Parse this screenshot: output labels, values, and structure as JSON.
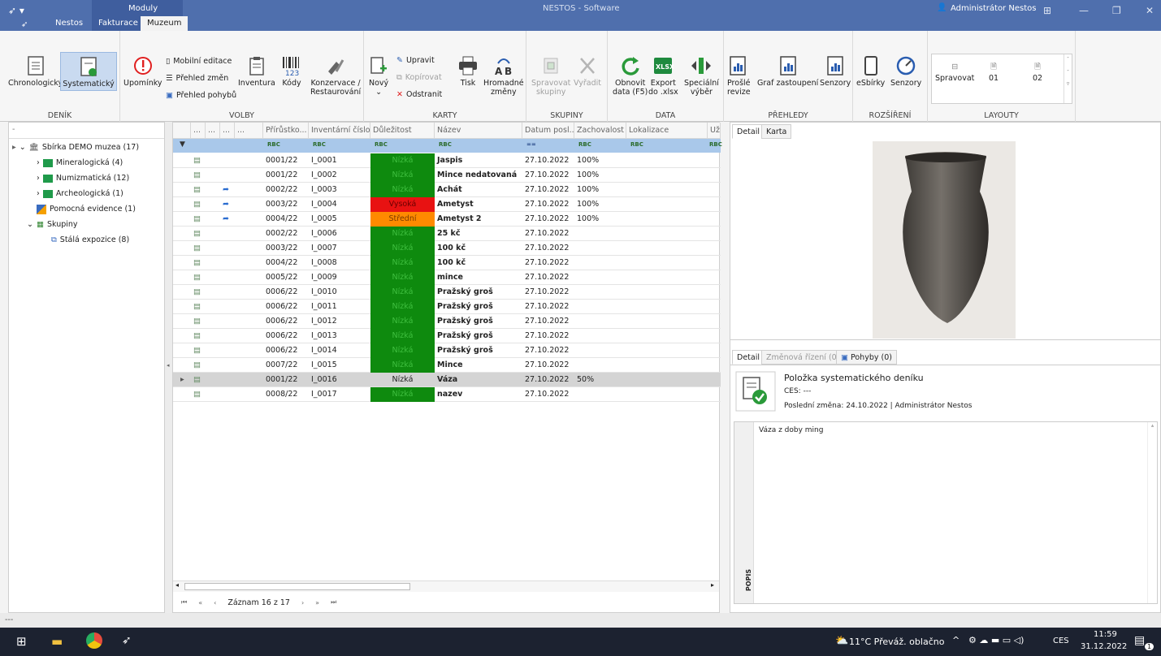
{
  "window": {
    "title": "NESTOS - Software",
    "context_tab": "Moduly",
    "user": "Administrátor Nestos"
  },
  "menu_tabs": [
    "Nestos",
    "Fakturace",
    "Muzeum"
  ],
  "ribbon": {
    "denik": {
      "caption": "DENÍK",
      "chronologicky": "Chronologický",
      "systematicky": "Systematický"
    },
    "volby": {
      "caption": "VOLBY",
      "upominky": "Upomínky",
      "mobilni_editace": "Mobilní editace",
      "prehled_zmen": "Přehled změn",
      "prehled_pohybu": "Přehled pohybů",
      "inventura": "Inventura",
      "kody": "Kódy",
      "konzervace_l1": "Konzervace /",
      "konzervace_l2": "Restaurování"
    },
    "karty": {
      "caption": "KARTY",
      "novy": "Nový",
      "upravit": "Upravit",
      "kopirovat": "Kopírovat",
      "odstranit": "Odstranit",
      "tisk": "Tisk",
      "hromadne_l1": "Hromadné",
      "hromadne_l2": "změny"
    },
    "skupiny": {
      "caption": "SKUPINY",
      "spravovat_l1": "Spravovat",
      "spravovat_l2": "skupiny",
      "vyradit": "Vyřadit"
    },
    "data": {
      "caption": "DATA",
      "obnovit_l1": "Obnovit",
      "obnovit_l2": "data (F5)",
      "export_l1": "Export",
      "export_l2": "do .xlsx",
      "specialni_l1": "Speciální",
      "specialni_l2": "výběr"
    },
    "prehledy": {
      "caption": "PŘEHLEDY",
      "prosle_l1": "Prošlé",
      "prosle_l2": "revize",
      "graf": "Graf zastoupení",
      "senzory": "Senzory"
    },
    "rozsireni": {
      "caption": "ROZŠÍŘENÍ",
      "esbirky": "eSbírky",
      "senzory": "Senzory"
    },
    "layouty": {
      "caption": "LAYOUTY",
      "spravovat": "Spravovat",
      "l01": "01",
      "l02": "02"
    }
  },
  "tree": {
    "header": "-",
    "items": [
      {
        "label": "Sbírka DEMO muzea (17)"
      },
      {
        "label": "Mineralogická (4)"
      },
      {
        "label": "Numizmatická (12)"
      },
      {
        "label": "Archeologická (1)"
      },
      {
        "label": "Pomocná evidence (1)"
      },
      {
        "label": "Skupiny"
      },
      {
        "label": "Stálá expozice (8)"
      }
    ]
  },
  "grid": {
    "columns": {
      "c1": "...",
      "c2": "...",
      "c3": "...",
      "c4": "...",
      "prirustek": "Přírůstko...",
      "inv": "Inventární číslo",
      "dulezitost": "Důležitost",
      "nazev": "Název",
      "datum": "Datum posl...",
      "zach": "Zachovalost",
      "lokalizace": "Lokalizace",
      "uz": "Už"
    },
    "filter": {
      "tag": "RBC",
      "eq": "=="
    },
    "rows": [
      {
        "p": "0001/22",
        "i": "I_0001",
        "d": "Nízká",
        "n": "Jaspis",
        "dt": "27.10.2022",
        "z": "100%"
      },
      {
        "p": "0001/22",
        "i": "I_0002",
        "d": "Nízká",
        "n": "Mince nedatovaná",
        "dt": "27.10.2022",
        "z": "100%"
      },
      {
        "p": "0002/22",
        "i": "I_0003",
        "d": "Nízká",
        "n": "Achát",
        "dt": "27.10.2022",
        "z": "100%"
      },
      {
        "p": "0003/22",
        "i": "I_0004",
        "d": "Vysoká",
        "n": "Ametyst",
        "dt": "27.10.2022",
        "z": "100%"
      },
      {
        "p": "0004/22",
        "i": "I_0005",
        "d": "Střední",
        "n": "Ametyst 2",
        "dt": "27.10.2022",
        "z": "100%"
      },
      {
        "p": "0002/22",
        "i": "I_0006",
        "d": "Nízká",
        "n": "25 kč",
        "dt": "27.10.2022",
        "z": ""
      },
      {
        "p": "0003/22",
        "i": "I_0007",
        "d": "Nízká",
        "n": "100 kč",
        "dt": "27.10.2022",
        "z": ""
      },
      {
        "p": "0004/22",
        "i": "I_0008",
        "d": "Nízká",
        "n": "100 kč",
        "dt": "27.10.2022",
        "z": ""
      },
      {
        "p": "0005/22",
        "i": "I_0009",
        "d": "Nízká",
        "n": "mince",
        "dt": "27.10.2022",
        "z": ""
      },
      {
        "p": "0006/22",
        "i": "I_0010",
        "d": "Nízká",
        "n": "Pražský groš",
        "dt": "27.10.2022",
        "z": ""
      },
      {
        "p": "0006/22",
        "i": "I_0011",
        "d": "Nízká",
        "n": "Pražský groš",
        "dt": "27.10.2022",
        "z": ""
      },
      {
        "p": "0006/22",
        "i": "I_0012",
        "d": "Nízká",
        "n": "Pražský groš",
        "dt": "27.10.2022",
        "z": ""
      },
      {
        "p": "0006/22",
        "i": "I_0013",
        "d": "Nízká",
        "n": "Pražský groš",
        "dt": "27.10.2022",
        "z": ""
      },
      {
        "p": "0006/22",
        "i": "I_0014",
        "d": "Nízká",
        "n": "Pražský groš",
        "dt": "27.10.2022",
        "z": ""
      },
      {
        "p": "0007/22",
        "i": "I_0015",
        "d": "Nízká",
        "n": "Mince",
        "dt": "27.10.2022",
        "z": ""
      },
      {
        "p": "0001/22",
        "i": "I_0016",
        "d": "Nízká",
        "n": "Váza",
        "dt": "27.10.2022",
        "z": "50%"
      },
      {
        "p": "0008/22",
        "i": "I_0017",
        "d": "Nízká",
        "n": "nazev",
        "dt": "27.10.2022",
        "z": ""
      }
    ],
    "pager": "Záznam 16 z 17"
  },
  "right": {
    "tabs_top": {
      "detail": "Detail",
      "karta": "Karta"
    },
    "tabs_bottom": {
      "detail": "Detail",
      "zmenova": "Změnová řízení (0)",
      "pohyby": "Pohyby (0)"
    },
    "item_title": "Položka systematického deníku",
    "ces": "CES: ---",
    "last_change": "Poslední změna:  24.10.2022 | Administrátor Nestos",
    "popis_label": "POPIS",
    "popis_text": "Váza z doby ming"
  },
  "status": "---",
  "taskbar": {
    "weather": "11°C  Převáž. oblačno",
    "lang": "CES",
    "time": "11:59",
    "date": "31.12.2022",
    "notif": "1"
  },
  "colors": {
    "title": "#4f6fad",
    "low": "#0e8a0e",
    "high": "#e81212",
    "mid": "#ff8a00",
    "filter": "#a9c8ea",
    "selected": "#d4d4d4"
  }
}
